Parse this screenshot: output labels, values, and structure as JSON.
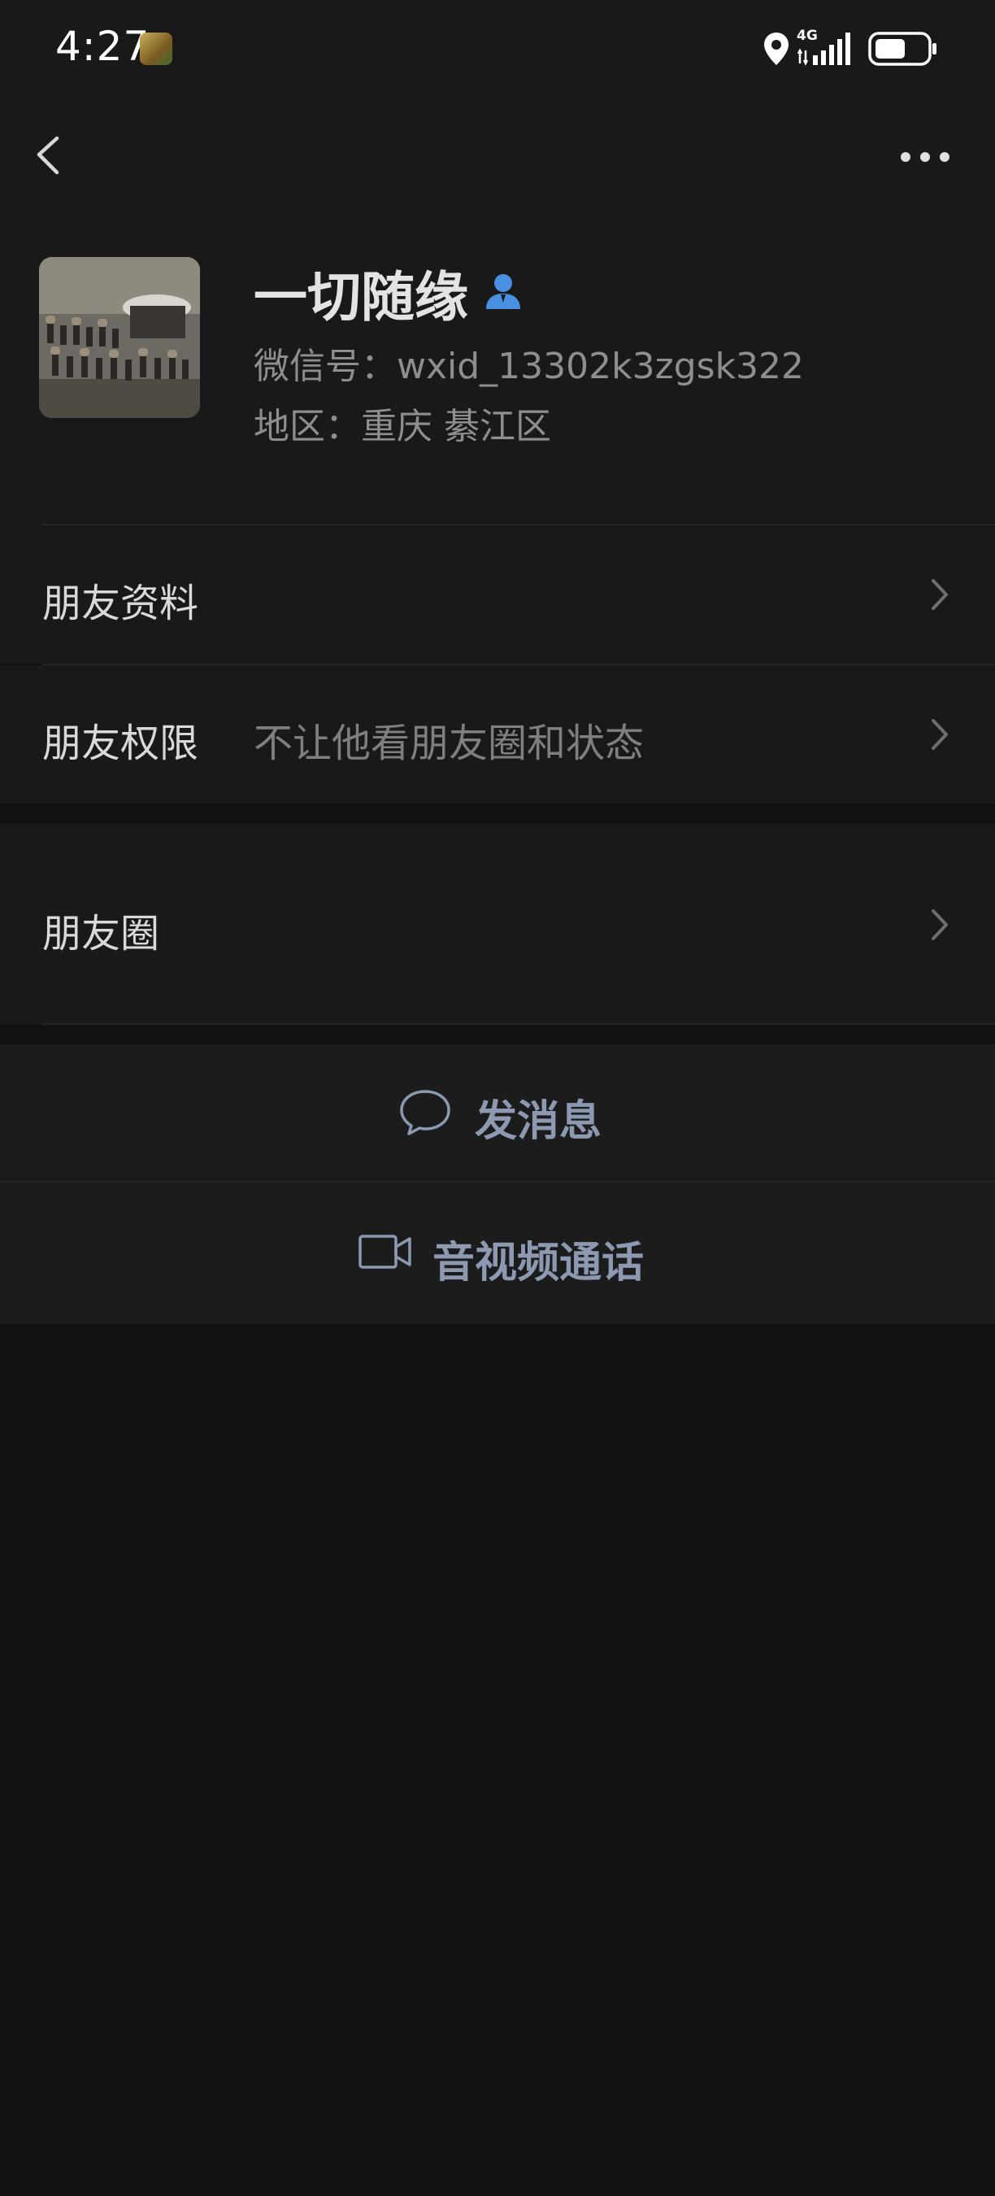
{
  "status_bar": {
    "time": "4:27",
    "network": "4G"
  },
  "nav": {
    "back_icon": "chevron-left-icon",
    "more_icon": "more-horizontal-icon"
  },
  "profile": {
    "name": "一切随缘",
    "wechat_id": "微信号：wxid_13302k3zgsk322",
    "region": "地区：重庆  綦江区",
    "badge_icon": "person-icon",
    "badge_color": "#4a90e2"
  },
  "menu": {
    "friend_info": "朋友资料",
    "friend_permissions": "朋友权限",
    "friend_permissions_value": "不让他看朋友圈和状态",
    "moments": "朋友圈"
  },
  "actions": {
    "send_message": "发消息",
    "av_call": "音视频通话",
    "accent_color": "#8c99b0"
  }
}
